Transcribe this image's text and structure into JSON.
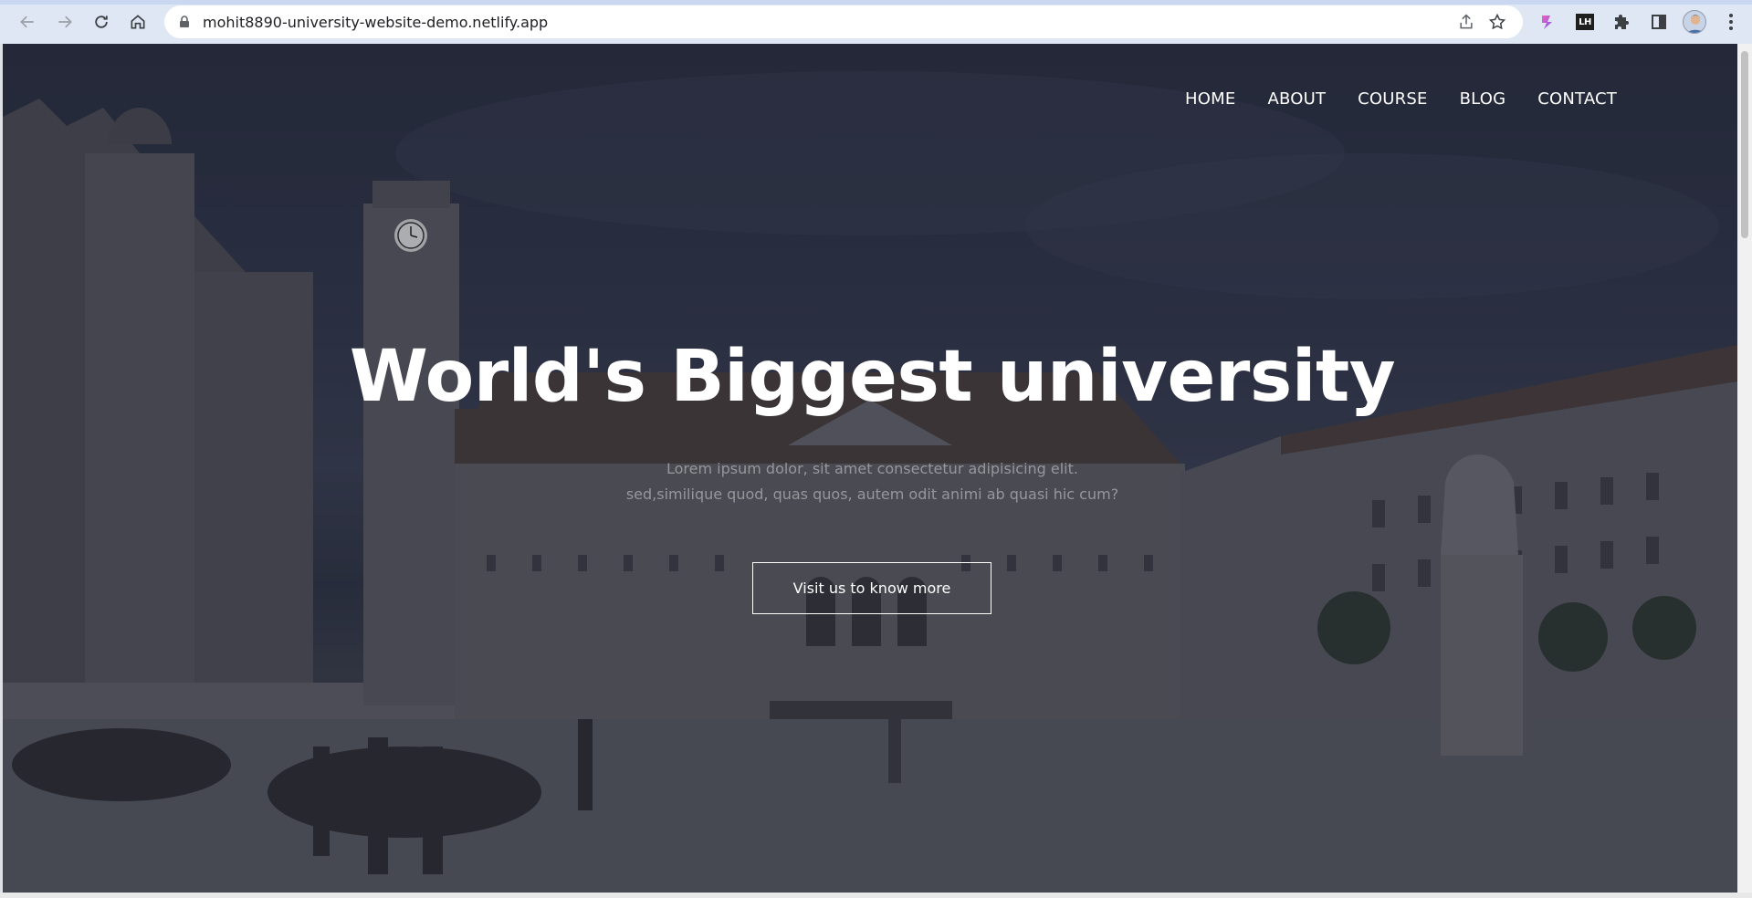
{
  "browser": {
    "url": "mohit8890-university-website-demo.netlify.app",
    "icons": [
      "back-icon",
      "forward-icon",
      "reload-icon",
      "home-icon",
      "lock-icon",
      "share-icon",
      "star-icon",
      "extension-gradient-icon",
      "extension-lh-icon",
      "puzzle-icon",
      "side-panel-icon",
      "avatar",
      "menu-icon"
    ],
    "extension_lh_label": "LH"
  },
  "page": {
    "nav": [
      {
        "label": "HOME"
      },
      {
        "label": "ABOUT"
      },
      {
        "label": "COURSE"
      },
      {
        "label": "BLOG"
      },
      {
        "label": "CONTACT"
      }
    ],
    "headline": "World's Biggest university",
    "subtext_line1": "Lorem ipsum dolor, sit amet consectetur adipisicing elit.",
    "subtext_line2": "sed,similique quod, quas quos, autem odit animi ab quasi hic cum?",
    "cta_label": "Visit us to know more"
  },
  "colors": {
    "overlay": "#1a1e30",
    "text": "#ffffff",
    "chrome": "#dfe7f5"
  }
}
